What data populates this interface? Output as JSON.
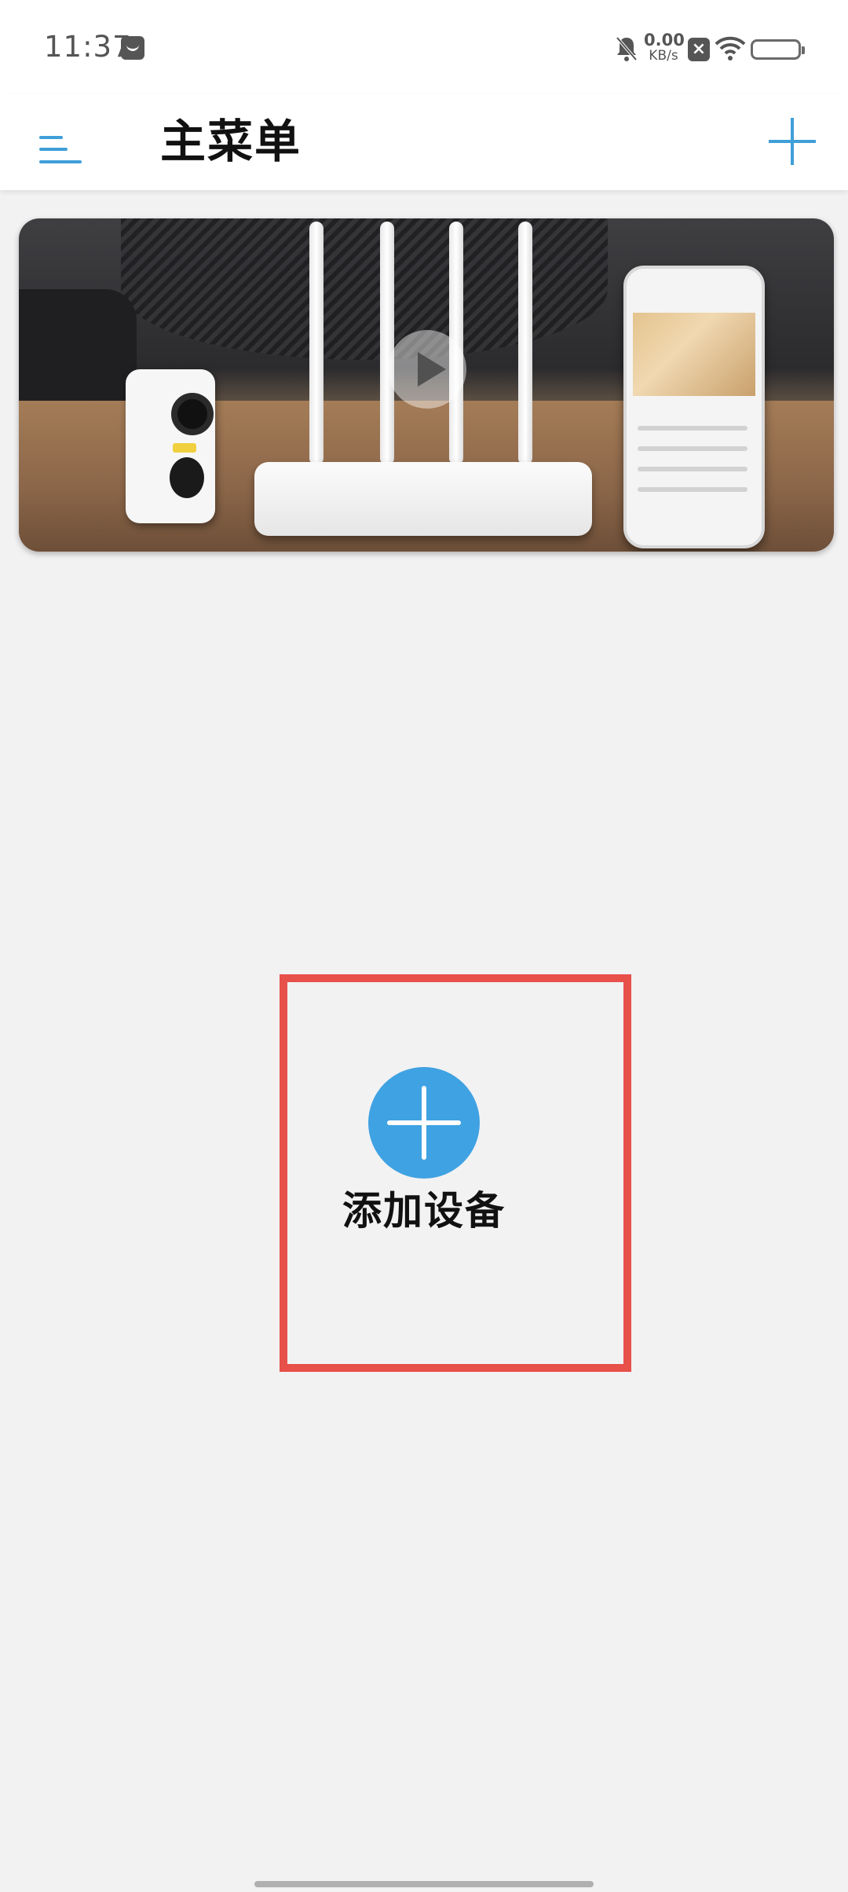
{
  "status_bar": {
    "time": "11:37",
    "net_speed_value": "0.00",
    "net_speed_unit": "KB/s",
    "icons": [
      "message-icon",
      "bell-muted-icon",
      "close-box-icon",
      "wifi-icon",
      "battery-icon"
    ]
  },
  "header": {
    "title": "主菜单",
    "menu_icon": "hamburger-icon",
    "add_icon": "plus-icon"
  },
  "banner": {
    "media": "promo-video",
    "play_icon": "play-icon"
  },
  "main": {
    "add_device_label": "添加设备",
    "add_device_icon": "plus-circle-icon"
  },
  "colors": {
    "accent": "#3fa2e2",
    "highlight": "#e8504a",
    "background": "#f2f2f3"
  }
}
